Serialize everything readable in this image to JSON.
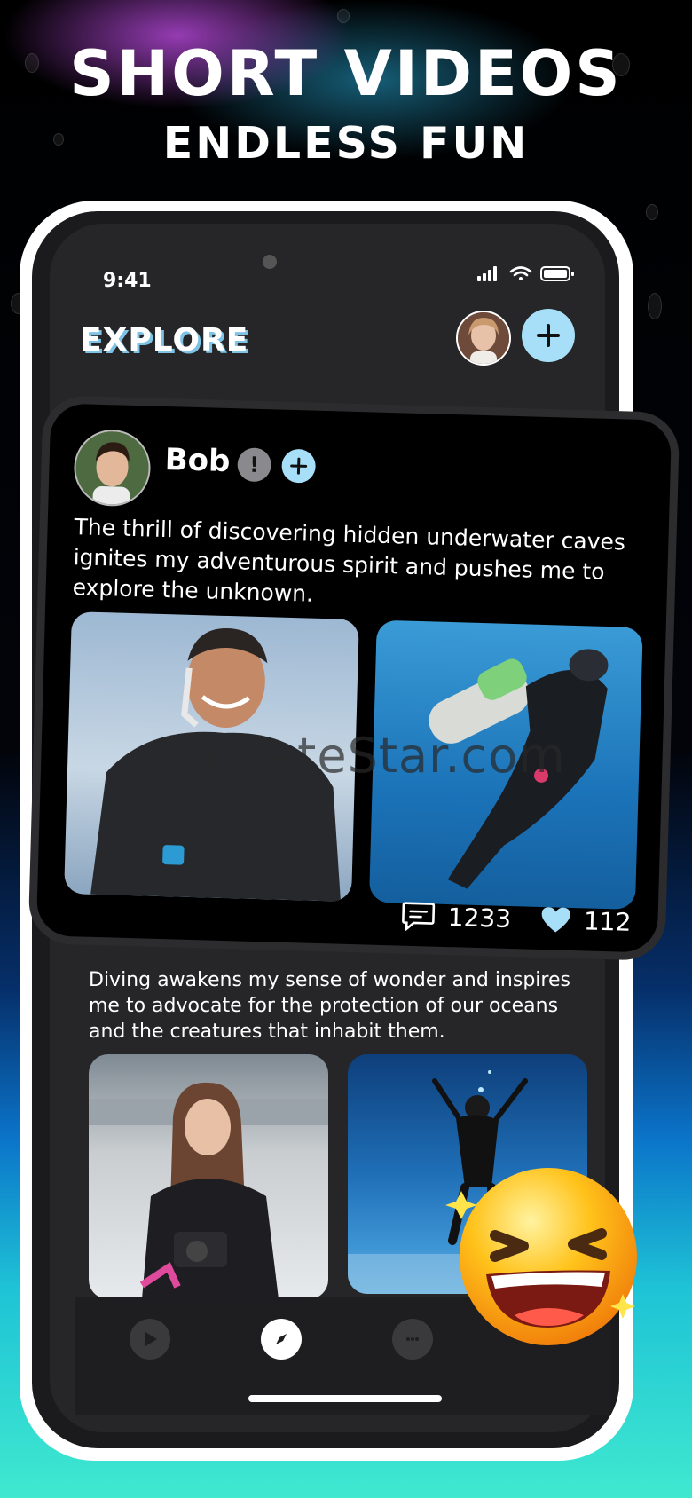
{
  "promo": {
    "headline_line1": "SHORT VIDEOS",
    "headline_line2": "ENDLESS FUN"
  },
  "status_bar": {
    "time": "9:41"
  },
  "header": {
    "title": "EXPLORE"
  },
  "featured_post": {
    "author": "Bob",
    "text": "The thrill of discovering hidden underwater caves ignites my adventurous spirit and pushes me to explore the unknown.",
    "comments_count": "1233",
    "likes_count": "112"
  },
  "second_post": {
    "text": "Diving awakens my sense of wonder and inspires me to advocate for the protection of our oceans and the creatures that inhabit them."
  },
  "watermark": "UpdateStar.com",
  "colors": {
    "accent": "#a7dff8",
    "title_shadow": "#7ec3e6",
    "background_teal": "#3fe9cf"
  }
}
